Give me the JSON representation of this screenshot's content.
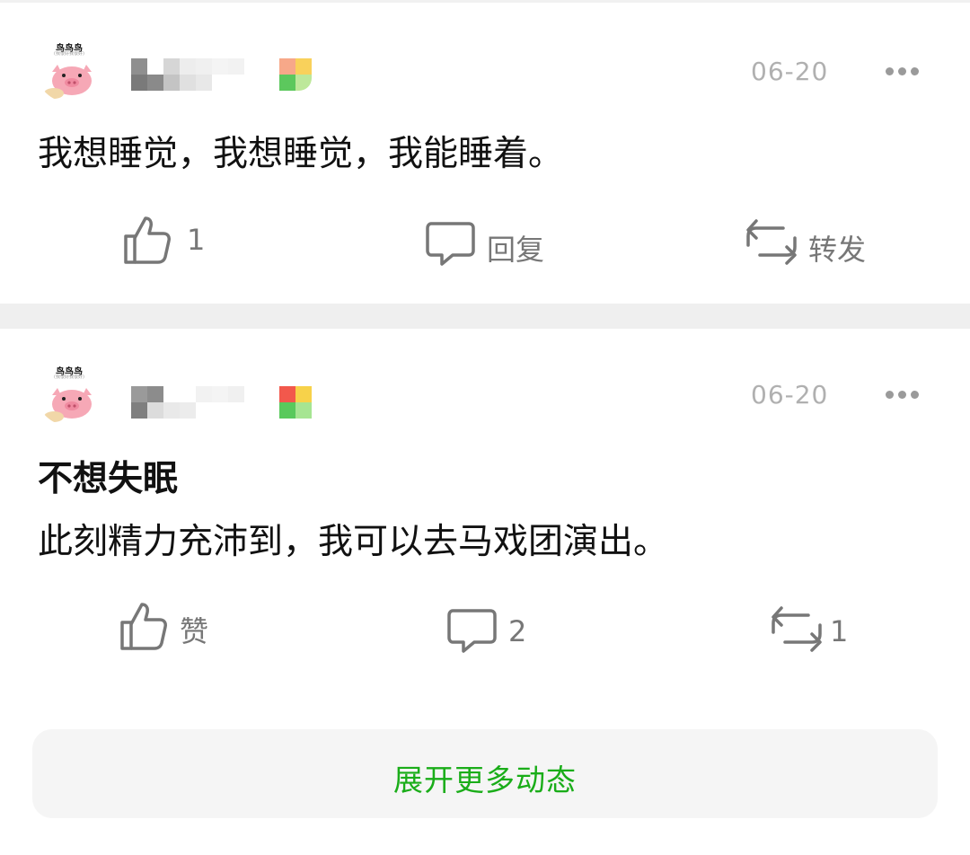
{
  "posts": [
    {
      "avatar_label": "鸟鸟鸟",
      "avatar_sub": "(我很好我很好)",
      "time": "06-20",
      "title": "",
      "text": "我想睡觉，我想睡觉，我能睡着。",
      "like_label": "1",
      "comment_label": "回复",
      "repost_label": "转发",
      "level_colors": [
        "#f7a889",
        "#f9d15b",
        "#5cc85d",
        "#bde89a"
      ]
    },
    {
      "avatar_label": "鸟鸟鸟",
      "avatar_sub": "(我很好我很好)",
      "time": "06-20",
      "title": "不想失眠",
      "text": "此刻精力充沛到，我可以去马戏团演出。",
      "like_label": "赞",
      "comment_label": "2",
      "repost_label": "1",
      "level_colors": [
        "#f2584c",
        "#f7d24a",
        "#59c95c",
        "#a6e592"
      ]
    }
  ],
  "footer": {
    "expand_label": "展开更多动态"
  },
  "icons": {
    "more": "more-horizontal-icon",
    "like": "thumbs-up-icon",
    "comment": "comment-bubble-icon",
    "repost": "repost-icon"
  },
  "colors": {
    "accent_green": "#1aad19",
    "time_gray": "#b0b0b0",
    "action_gray": "#777777",
    "divider": "#efefef"
  }
}
